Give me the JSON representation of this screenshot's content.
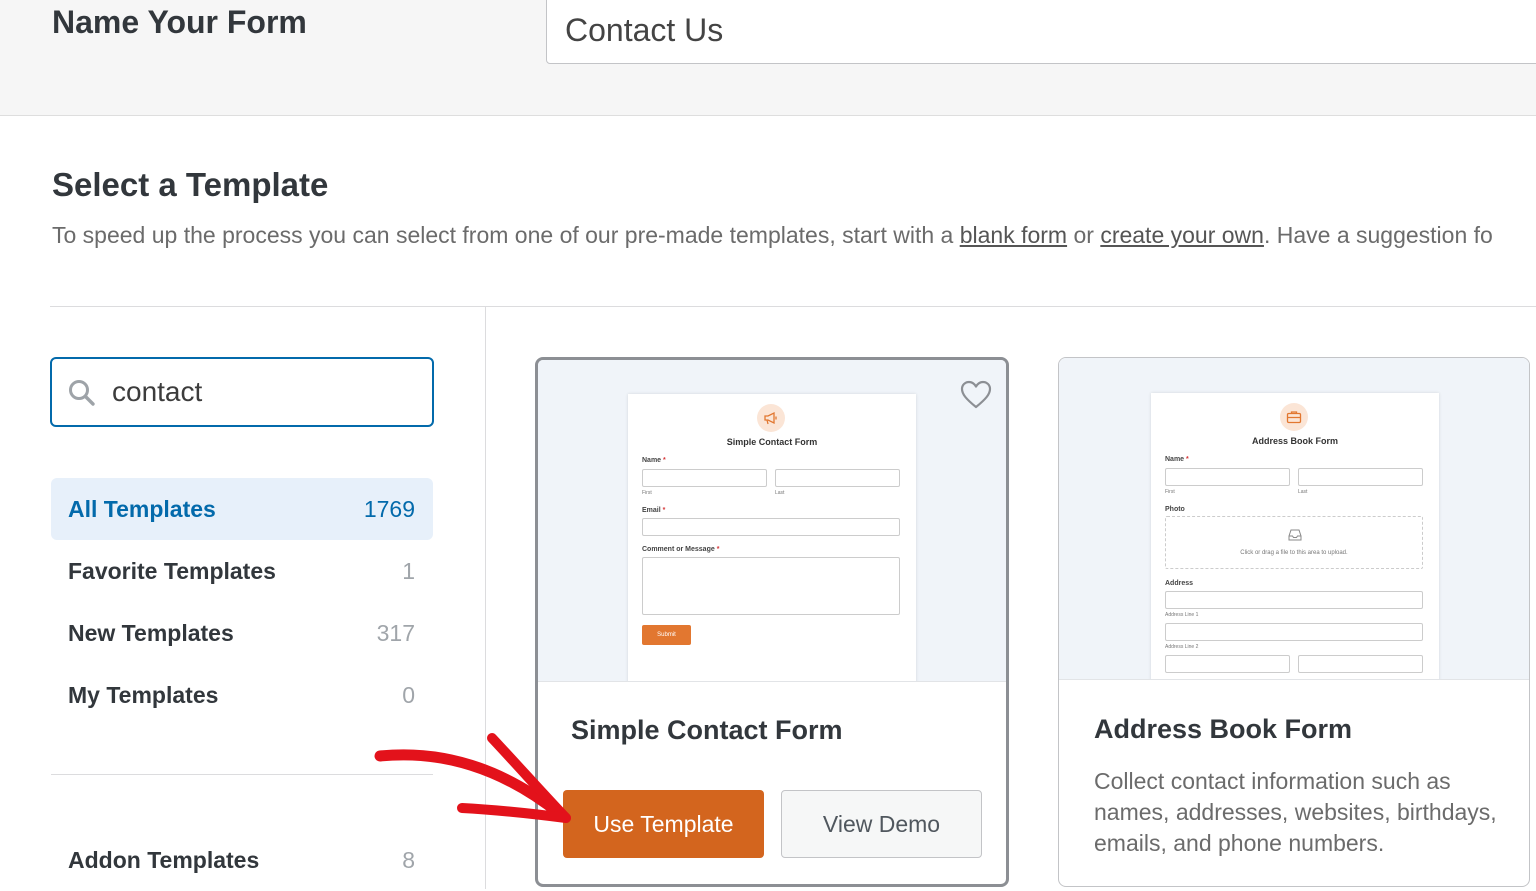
{
  "header": {
    "form_name_label": "Name Your Form",
    "form_name_value": "Contact Us"
  },
  "template_section": {
    "title": "Select a Template",
    "desc_before": "To speed up the process you can select from one of our pre-made templates, start with a ",
    "blank_form_link": "blank form",
    "desc_or": " or ",
    "create_own_link": "create your own",
    "desc_after": ". Have a suggestion fo"
  },
  "search": {
    "value": "contact",
    "icon": "search-icon"
  },
  "categories": [
    {
      "label": "All Templates",
      "count": "1769",
      "active": true
    },
    {
      "label": "Favorite Templates",
      "count": "1"
    },
    {
      "label": "New Templates",
      "count": "317"
    },
    {
      "label": "My Templates",
      "count": "0"
    }
  ],
  "addon": {
    "label": "Addon Templates",
    "count": "8"
  },
  "cards": [
    {
      "title": "Simple Contact Form",
      "preview": {
        "title": "Simple Contact Form",
        "name_label": "Name",
        "first": "First",
        "last": "Last",
        "email_label": "Email",
        "message_label": "Comment or Message",
        "submit": "Submit"
      },
      "use_label": "Use Template",
      "demo_label": "View Demo"
    },
    {
      "title": "Address Book Form",
      "description": "Collect contact information such as names, addresses, websites, birthdays, emails, and phone numbers.",
      "preview": {
        "title": "Address Book Form",
        "name_label": "Name",
        "first": "First",
        "last": "Last",
        "photo_label": "Photo",
        "upload_text": "Click or drag a file to this area to upload.",
        "address_label": "Address",
        "line1": "Address Line 1",
        "line2": "Address Line 2"
      }
    }
  ],
  "colors": {
    "accent": "#036aab",
    "use_button": "#d3651e",
    "annotation_arrow": "#e3121b"
  }
}
